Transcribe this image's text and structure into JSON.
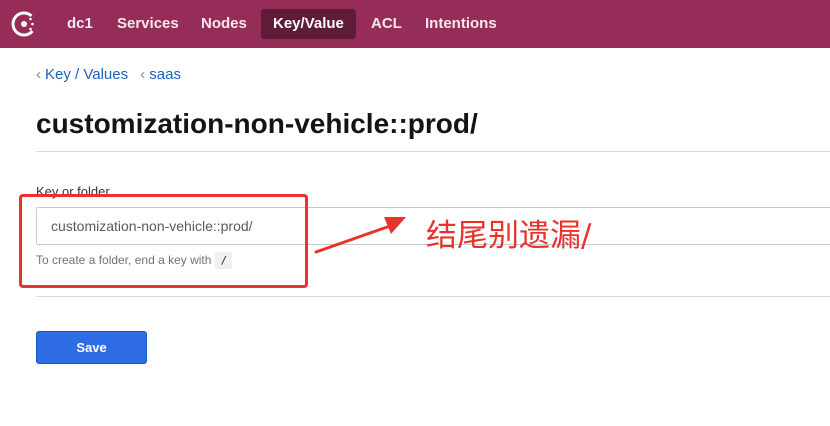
{
  "nav": {
    "items": [
      {
        "label": "dc1"
      },
      {
        "label": "Services"
      },
      {
        "label": "Nodes"
      },
      {
        "label": "Key/Value",
        "active": true
      },
      {
        "label": "ACL"
      },
      {
        "label": "Intentions"
      }
    ]
  },
  "breadcrumb": {
    "items": [
      {
        "label": "Key / Values"
      },
      {
        "label": "saas"
      }
    ]
  },
  "page": {
    "title": "customization-non-vehicle::prod/"
  },
  "form": {
    "key_label": "Key or folder",
    "key_value": "customization-non-vehicle::prod/",
    "help_text": "To create a folder, end a key with",
    "help_code": "/",
    "save_label": "Save"
  },
  "annotation": {
    "text": "结尾别遗漏/",
    "color": "#e8322b"
  },
  "colors": {
    "brand": "#962d59",
    "nav_active": "#5e1c38",
    "primary_button": "#2e6de6",
    "link": "#1f5fbf"
  }
}
